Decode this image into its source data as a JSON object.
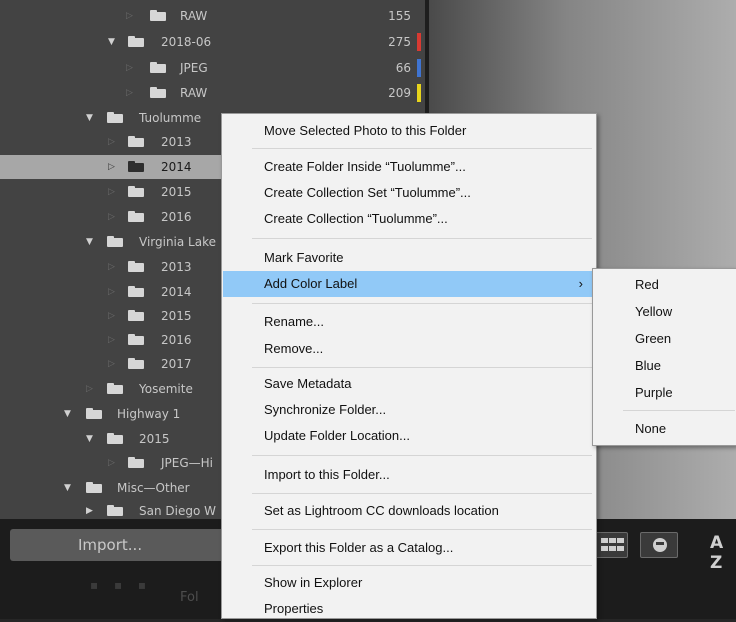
{
  "folder_tree": {
    "rows": [
      {
        "name": "RAW",
        "count": "155",
        "tag": ""
      },
      {
        "name": "2018-06",
        "count": "275",
        "tag": "#d83a32"
      },
      {
        "name": "JPEG",
        "count": "66",
        "tag": "#3f74d2"
      },
      {
        "name": "RAW",
        "count": "209",
        "tag": "#e7d41c"
      },
      {
        "name": "Tuolumme",
        "count": "",
        "tag": ""
      },
      {
        "name": "2013",
        "count": "",
        "tag": ""
      },
      {
        "name": "2014",
        "count": "",
        "tag": ""
      },
      {
        "name": "2015",
        "count": "",
        "tag": ""
      },
      {
        "name": "2016",
        "count": "",
        "tag": ""
      },
      {
        "name": "Virginia Lake",
        "count": "",
        "tag": ""
      },
      {
        "name": "2013",
        "count": "",
        "tag": ""
      },
      {
        "name": "2014",
        "count": "",
        "tag": ""
      },
      {
        "name": "2015",
        "count": "",
        "tag": ""
      },
      {
        "name": "2016",
        "count": "",
        "tag": ""
      },
      {
        "name": "2017",
        "count": "",
        "tag": ""
      },
      {
        "name": "Yosemite",
        "count": "",
        "tag": ""
      },
      {
        "name": "Highway 1",
        "count": "",
        "tag": ""
      },
      {
        "name": "2015",
        "count": "",
        "tag": ""
      },
      {
        "name": "JPEG—Hi",
        "count": "",
        "tag": ""
      },
      {
        "name": "Misc—Other",
        "count": "",
        "tag": ""
      },
      {
        "name": "San Diego W",
        "count": "",
        "tag": ""
      }
    ]
  },
  "bottom": {
    "import_label": "Import...",
    "filmstrip_text": "Fol",
    "sort_icon": "A Z"
  },
  "context_menu": {
    "items": [
      {
        "label": "Move Selected Photo to this Folder"
      },
      {
        "label": "Create Folder Inside “Tuolumme”..."
      },
      {
        "label": "Create Collection Set “Tuolumme”..."
      },
      {
        "label": "Create Collection “Tuolumme”..."
      },
      {
        "label": "Mark Favorite"
      },
      {
        "label": "Add Color Label",
        "arrow": "›"
      },
      {
        "label": "Rename..."
      },
      {
        "label": "Remove..."
      },
      {
        "label": "Save Metadata"
      },
      {
        "label": "Synchronize Folder..."
      },
      {
        "label": "Update Folder Location..."
      },
      {
        "label": "Import to this Folder..."
      },
      {
        "label": "Set as Lightroom CC downloads location"
      },
      {
        "label": "Export this Folder as a Catalog..."
      },
      {
        "label": "Show in Explorer"
      },
      {
        "label": "Properties"
      }
    ]
  },
  "color_label_submenu": {
    "items": [
      {
        "label": "Red"
      },
      {
        "label": "Yellow"
      },
      {
        "label": "Green"
      },
      {
        "label": "Blue"
      },
      {
        "label": "Purple"
      },
      {
        "label": "None"
      }
    ]
  },
  "colors": {
    "menu_highlight": "#91c9f7",
    "selected_row": "#a7a7a7",
    "panel_bg": "#434343"
  },
  "icons": {
    "expanded_disclosure": "triangle-down-icon",
    "collapsed_disclosure": "triangle-right-icon",
    "folder": "folder-icon",
    "submenu_arrow": "chevron-right-icon"
  }
}
